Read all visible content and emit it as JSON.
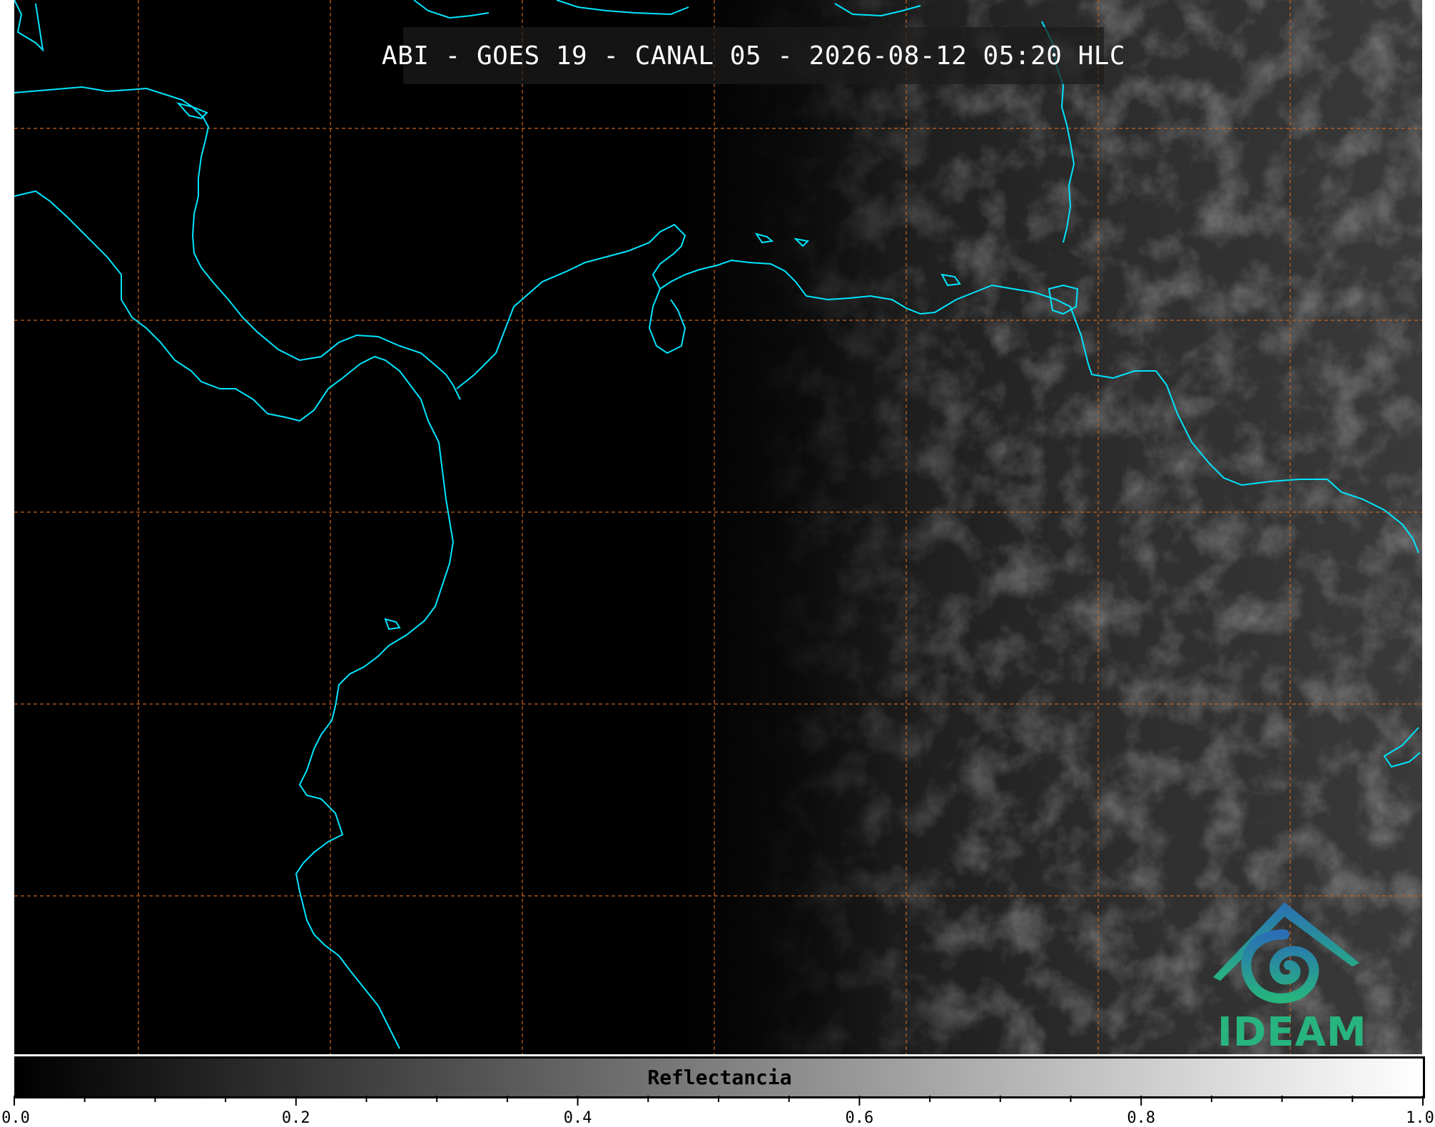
{
  "title": "ABI - GOES 19 - CANAL 05 - 2026-08-12 05:20 HLC",
  "colors": {
    "coastline": "#00e5ff",
    "gridline": "#c8641e",
    "background": "#000000",
    "logo_teal": "#27b47f",
    "logo_blue": "#2a6fb5"
  },
  "logo": {
    "name": "IDEAM logo",
    "text": "IDEAM"
  },
  "colorbar": {
    "label": "Reflectancia",
    "min": 0.0,
    "max": 1.0,
    "tick_labels": [
      "0.0",
      "0.2",
      "0.4",
      "0.6",
      "0.8",
      "1.0"
    ],
    "minor_step": 0.05,
    "colormap": "grayscale"
  },
  "map": {
    "gridline_style": "dashed",
    "vertical_gridlines": 7,
    "horizontal_gridlines": 5,
    "coastlines": "shown"
  }
}
